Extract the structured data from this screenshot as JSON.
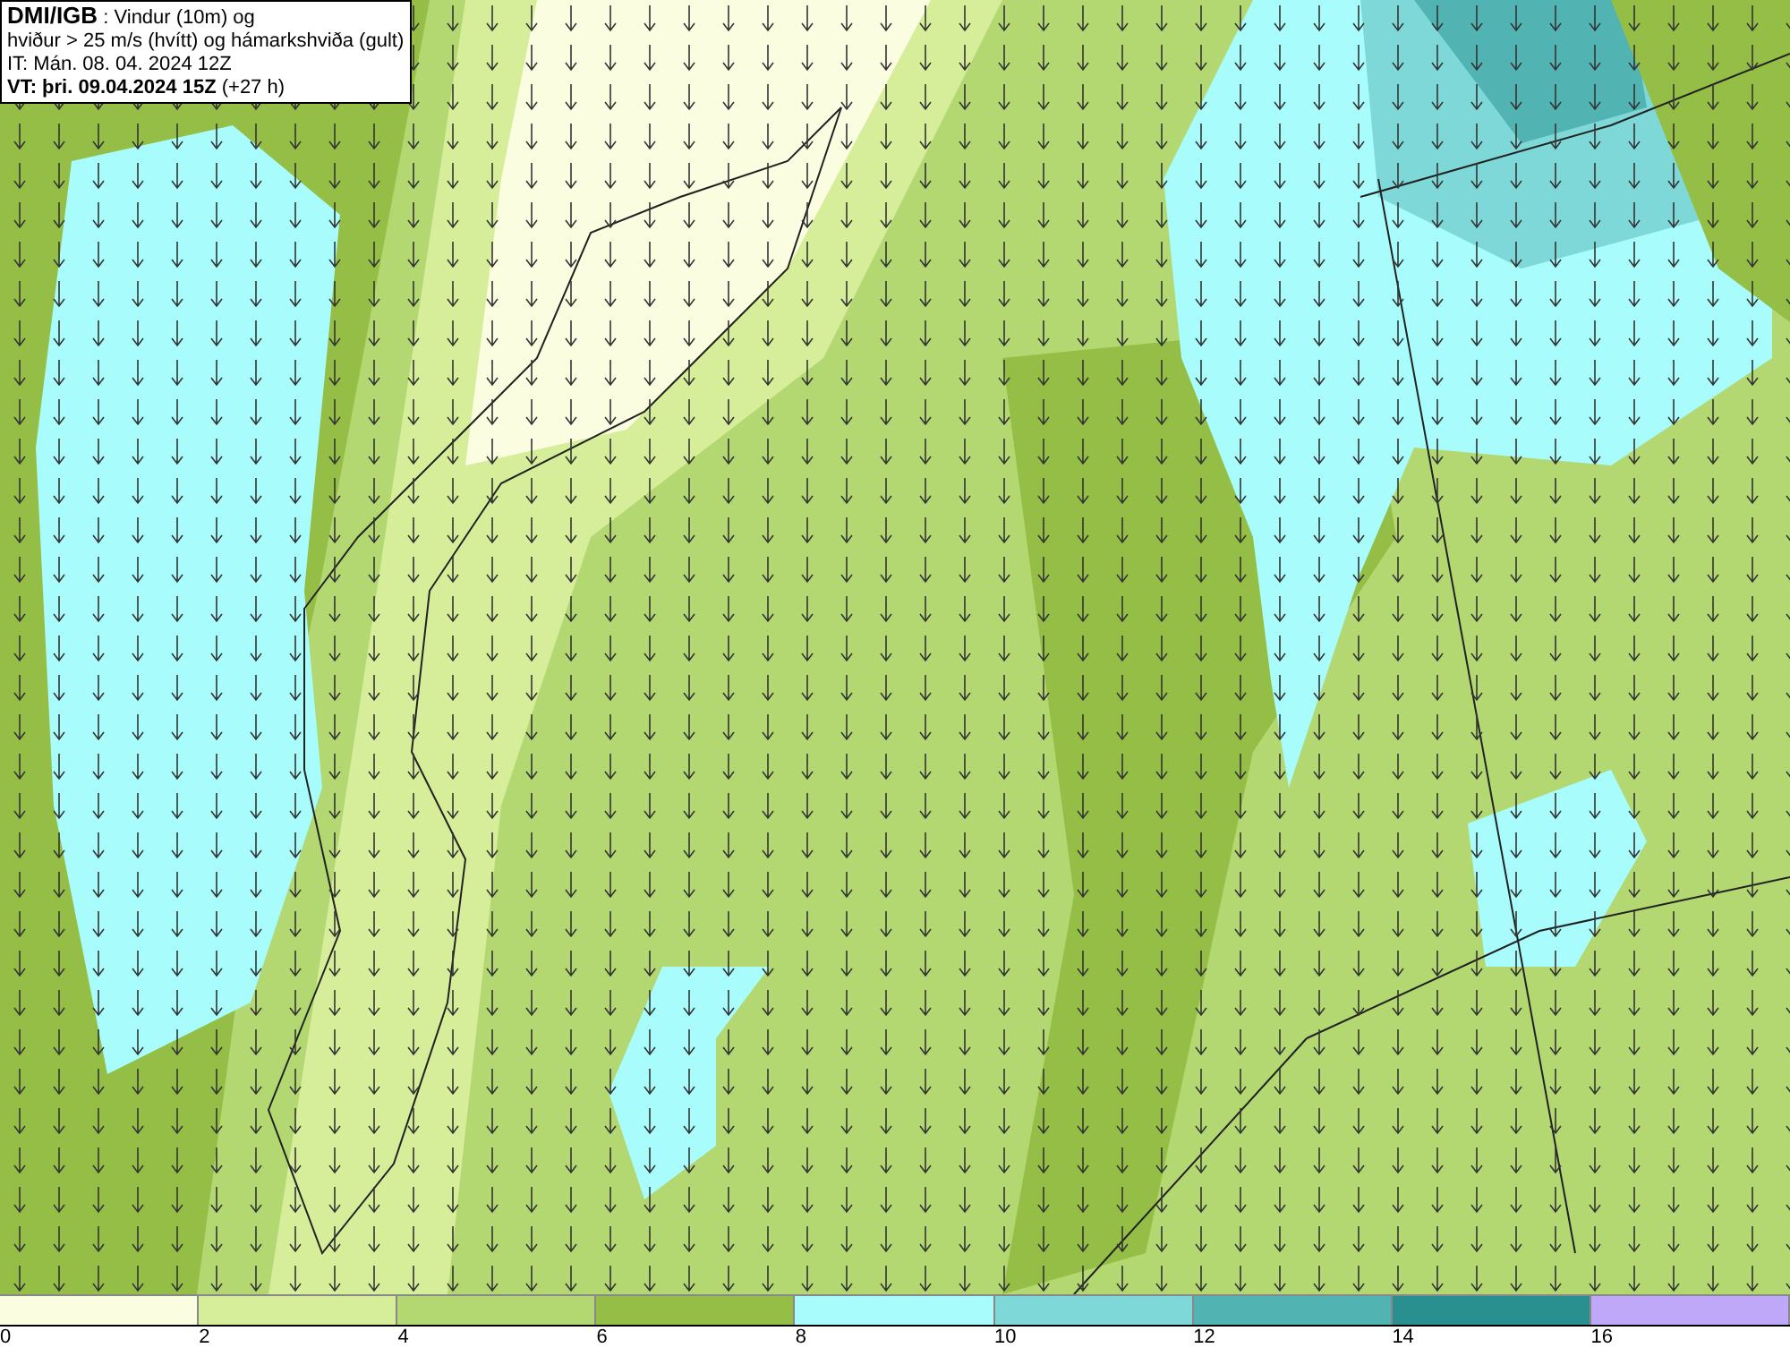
{
  "header": {
    "lines": [
      "**DMI/IGB** : Vindur (10m) og",
      "hviður > 25 m/s (hvítt) og hámarkshviða (gult)",
      "IT: Mán. 08. 04. 2024 12Z",
      "**VT: þri. 09.04.2024 15Z** (+27 h)"
    ]
  },
  "legend": {
    "swatches": [
      {
        "color": "#fafde0"
      },
      {
        "color": "#d6ee9a"
      },
      {
        "color": "#b3d872"
      },
      {
        "color": "#95be46"
      },
      {
        "color": "#a8fcfc"
      },
      {
        "color": "#7fd8d8"
      },
      {
        "color": "#52b3b3"
      },
      {
        "color": "#2a8f8f"
      },
      {
        "color": "#c0a8f8"
      }
    ],
    "ticks": [
      "0",
      "2",
      "4",
      "6",
      "8",
      "10",
      "12",
      "14",
      "16"
    ]
  }
}
